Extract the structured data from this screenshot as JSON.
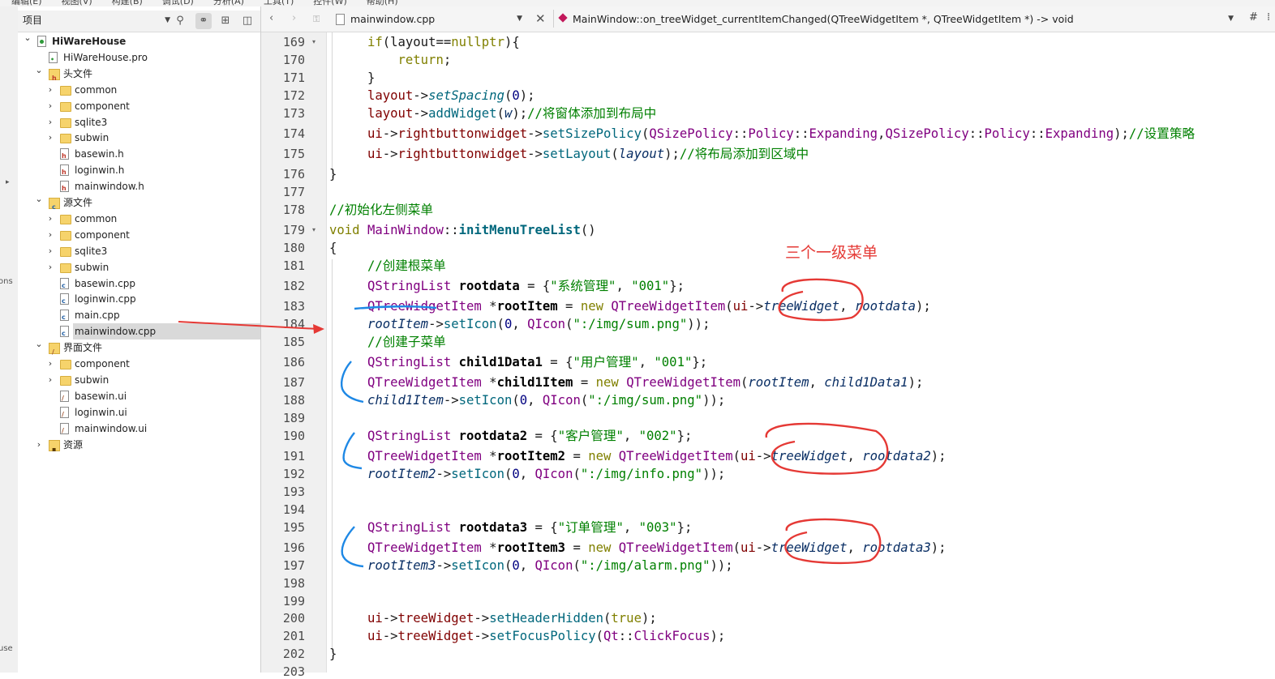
{
  "menubar": {
    "items": [
      "编辑(E)",
      "视图(V)",
      "构建(B)",
      "调试(D)",
      "分析(A)",
      "工具(T)",
      "控件(W)",
      "帮助(H)"
    ]
  },
  "leftstrip": {
    "clip1": "ons",
    "clip2": "use"
  },
  "project": {
    "combo_label": "项目",
    "tree": [
      {
        "label": "HiWareHouse",
        "level": 0,
        "icon": "project-icon",
        "expand": "open",
        "bold": true
      },
      {
        "label": "HiWareHouse.pro",
        "level": 1,
        "icon": "pro-file-icon",
        "expand": "none"
      },
      {
        "label": "头文件",
        "level": 1,
        "icon": "header-folder-icon",
        "expand": "open"
      },
      {
        "label": "common",
        "level": 2,
        "icon": "folder-icon",
        "expand": "closed"
      },
      {
        "label": "component",
        "level": 2,
        "icon": "folder-icon",
        "expand": "closed"
      },
      {
        "label": "sqlite3",
        "level": 2,
        "icon": "folder-icon",
        "expand": "closed"
      },
      {
        "label": "subwin",
        "level": 2,
        "icon": "folder-icon",
        "expand": "closed"
      },
      {
        "label": "basewin.h",
        "level": 2,
        "icon": "header-file-icon",
        "expand": "none"
      },
      {
        "label": "loginwin.h",
        "level": 2,
        "icon": "header-file-icon",
        "expand": "none"
      },
      {
        "label": "mainwindow.h",
        "level": 2,
        "icon": "header-file-icon",
        "expand": "none"
      },
      {
        "label": "源文件",
        "level": 1,
        "icon": "source-folder-icon",
        "expand": "open"
      },
      {
        "label": "common",
        "level": 2,
        "icon": "folder-icon",
        "expand": "closed"
      },
      {
        "label": "component",
        "level": 2,
        "icon": "folder-icon",
        "expand": "closed"
      },
      {
        "label": "sqlite3",
        "level": 2,
        "icon": "folder-icon",
        "expand": "closed"
      },
      {
        "label": "subwin",
        "level": 2,
        "icon": "folder-icon",
        "expand": "closed"
      },
      {
        "label": "basewin.cpp",
        "level": 2,
        "icon": "cpp-file-icon",
        "expand": "none"
      },
      {
        "label": "loginwin.cpp",
        "level": 2,
        "icon": "cpp-file-icon",
        "expand": "none"
      },
      {
        "label": "main.cpp",
        "level": 2,
        "icon": "cpp-file-icon",
        "expand": "none"
      },
      {
        "label": "mainwindow.cpp",
        "level": 2,
        "icon": "cpp-file-icon",
        "expand": "none",
        "selected": true
      },
      {
        "label": "界面文件",
        "level": 1,
        "icon": "form-folder-icon",
        "expand": "open"
      },
      {
        "label": "component",
        "level": 2,
        "icon": "folder-icon",
        "expand": "closed"
      },
      {
        "label": "subwin",
        "level": 2,
        "icon": "folder-icon",
        "expand": "closed"
      },
      {
        "label": "basewin.ui",
        "level": 2,
        "icon": "ui-file-icon",
        "expand": "none"
      },
      {
        "label": "loginwin.ui",
        "level": 2,
        "icon": "ui-file-icon",
        "expand": "none"
      },
      {
        "label": "mainwindow.ui",
        "level": 2,
        "icon": "ui-file-icon",
        "expand": "none"
      },
      {
        "label": "资源",
        "level": 1,
        "icon": "resource-folder-icon",
        "expand": "closed"
      }
    ]
  },
  "editor": {
    "file_name": "mainwindow.cpp",
    "function_name": "MainWindow::on_treeWidget_currentItemChanged(QTreeWidgetItem *, QTreeWidgetItem *) -> void",
    "hash_label": "#",
    "line_numbers": [
      "169",
      "170",
      "171",
      "172",
      "173",
      "174",
      "175",
      "176",
      "177",
      "178",
      "179",
      "180",
      "181",
      "182",
      "183",
      "184",
      "185",
      "186",
      "187",
      "188",
      "189",
      "190",
      "191",
      "192",
      "193",
      "194",
      "195",
      "196",
      "197",
      "198",
      "199",
      "200",
      "201",
      "202",
      "203"
    ],
    "fold_markers": {
      "169": "▾",
      "179": "▾"
    }
  },
  "annotation": {
    "text": "三个一级菜单",
    "color": "#e53935"
  },
  "colors": {
    "keyword": "#808000",
    "type": "#800080",
    "function": "#00677c",
    "string": "#008000",
    "comment": "#008000",
    "number": "#000080",
    "selection": "#d9d9d9",
    "annotation_red": "#e53935",
    "annotation_blue": "#1e88e5"
  }
}
